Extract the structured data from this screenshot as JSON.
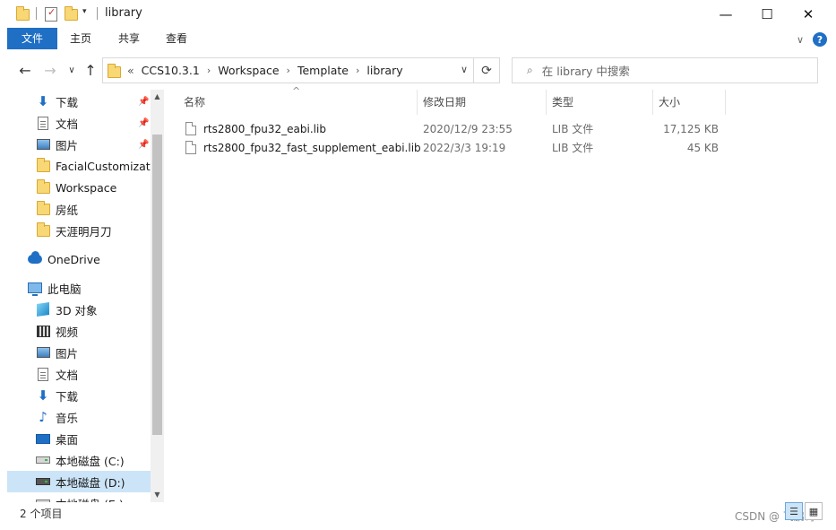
{
  "window": {
    "title": "library",
    "minimize_glyph": "—",
    "maximize_glyph": "☐",
    "close_glyph": "✕"
  },
  "ribbon": {
    "tabs": [
      "文件",
      "主页",
      "共享",
      "查看"
    ]
  },
  "address": {
    "overflow_glyph": "«",
    "crumbs": [
      "CCS10.3.1",
      "Workspace",
      "Template",
      "library"
    ]
  },
  "search": {
    "placeholder": "在 library 中搜索"
  },
  "nav": {
    "quick_access": [
      {
        "label": "下载",
        "icon": "download-icon",
        "pinned": true
      },
      {
        "label": "文档",
        "icon": "document-icon",
        "pinned": true
      },
      {
        "label": "图片",
        "icon": "pictures-icon",
        "pinned": true
      },
      {
        "label": "FacialCustomizatio",
        "icon": "folder-icon",
        "pinned": false
      },
      {
        "label": "Workspace",
        "icon": "folder-icon",
        "pinned": false
      },
      {
        "label": "房纸",
        "icon": "folder-icon",
        "pinned": false
      },
      {
        "label": "天涯明月刀",
        "icon": "folder-icon",
        "pinned": false
      }
    ],
    "onedrive": {
      "label": "OneDrive",
      "icon": "cloud-icon"
    },
    "this_pc": {
      "label": "此电脑",
      "icon": "computer-icon"
    },
    "pc_items": [
      {
        "label": "3D 对象",
        "icon": "3d-objects-icon"
      },
      {
        "label": "视频",
        "icon": "videos-icon"
      },
      {
        "label": "图片",
        "icon": "pictures-icon"
      },
      {
        "label": "文档",
        "icon": "document-icon"
      },
      {
        "label": "下载",
        "icon": "download-icon"
      },
      {
        "label": "音乐",
        "icon": "music-icon"
      },
      {
        "label": "桌面",
        "icon": "desktop-icon"
      },
      {
        "label": "本地磁盘 (C:)",
        "icon": "drive-icon"
      },
      {
        "label": "本地磁盘 (D:)",
        "icon": "drive-icon"
      },
      {
        "label": "本地磁盘 (E:)",
        "icon": "drive-icon"
      }
    ],
    "selected": "本地磁盘 (D:)"
  },
  "columns": {
    "name": "名称",
    "modified": "修改日期",
    "type": "类型",
    "size": "大小"
  },
  "files": [
    {
      "name": "rts2800_fpu32_eabi.lib",
      "modified": "2020/12/9 23:55",
      "type": "LIB 文件",
      "size": "17,125 KB"
    },
    {
      "name": "rts2800_fpu32_fast_supplement_eabi.lib",
      "modified": "2022/3/3 19:19",
      "type": "LIB 文件",
      "size": "45 KB"
    }
  ],
  "status": {
    "item_count": "2 个项目"
  },
  "watermark": "CSDN @ 飞鹏哥"
}
